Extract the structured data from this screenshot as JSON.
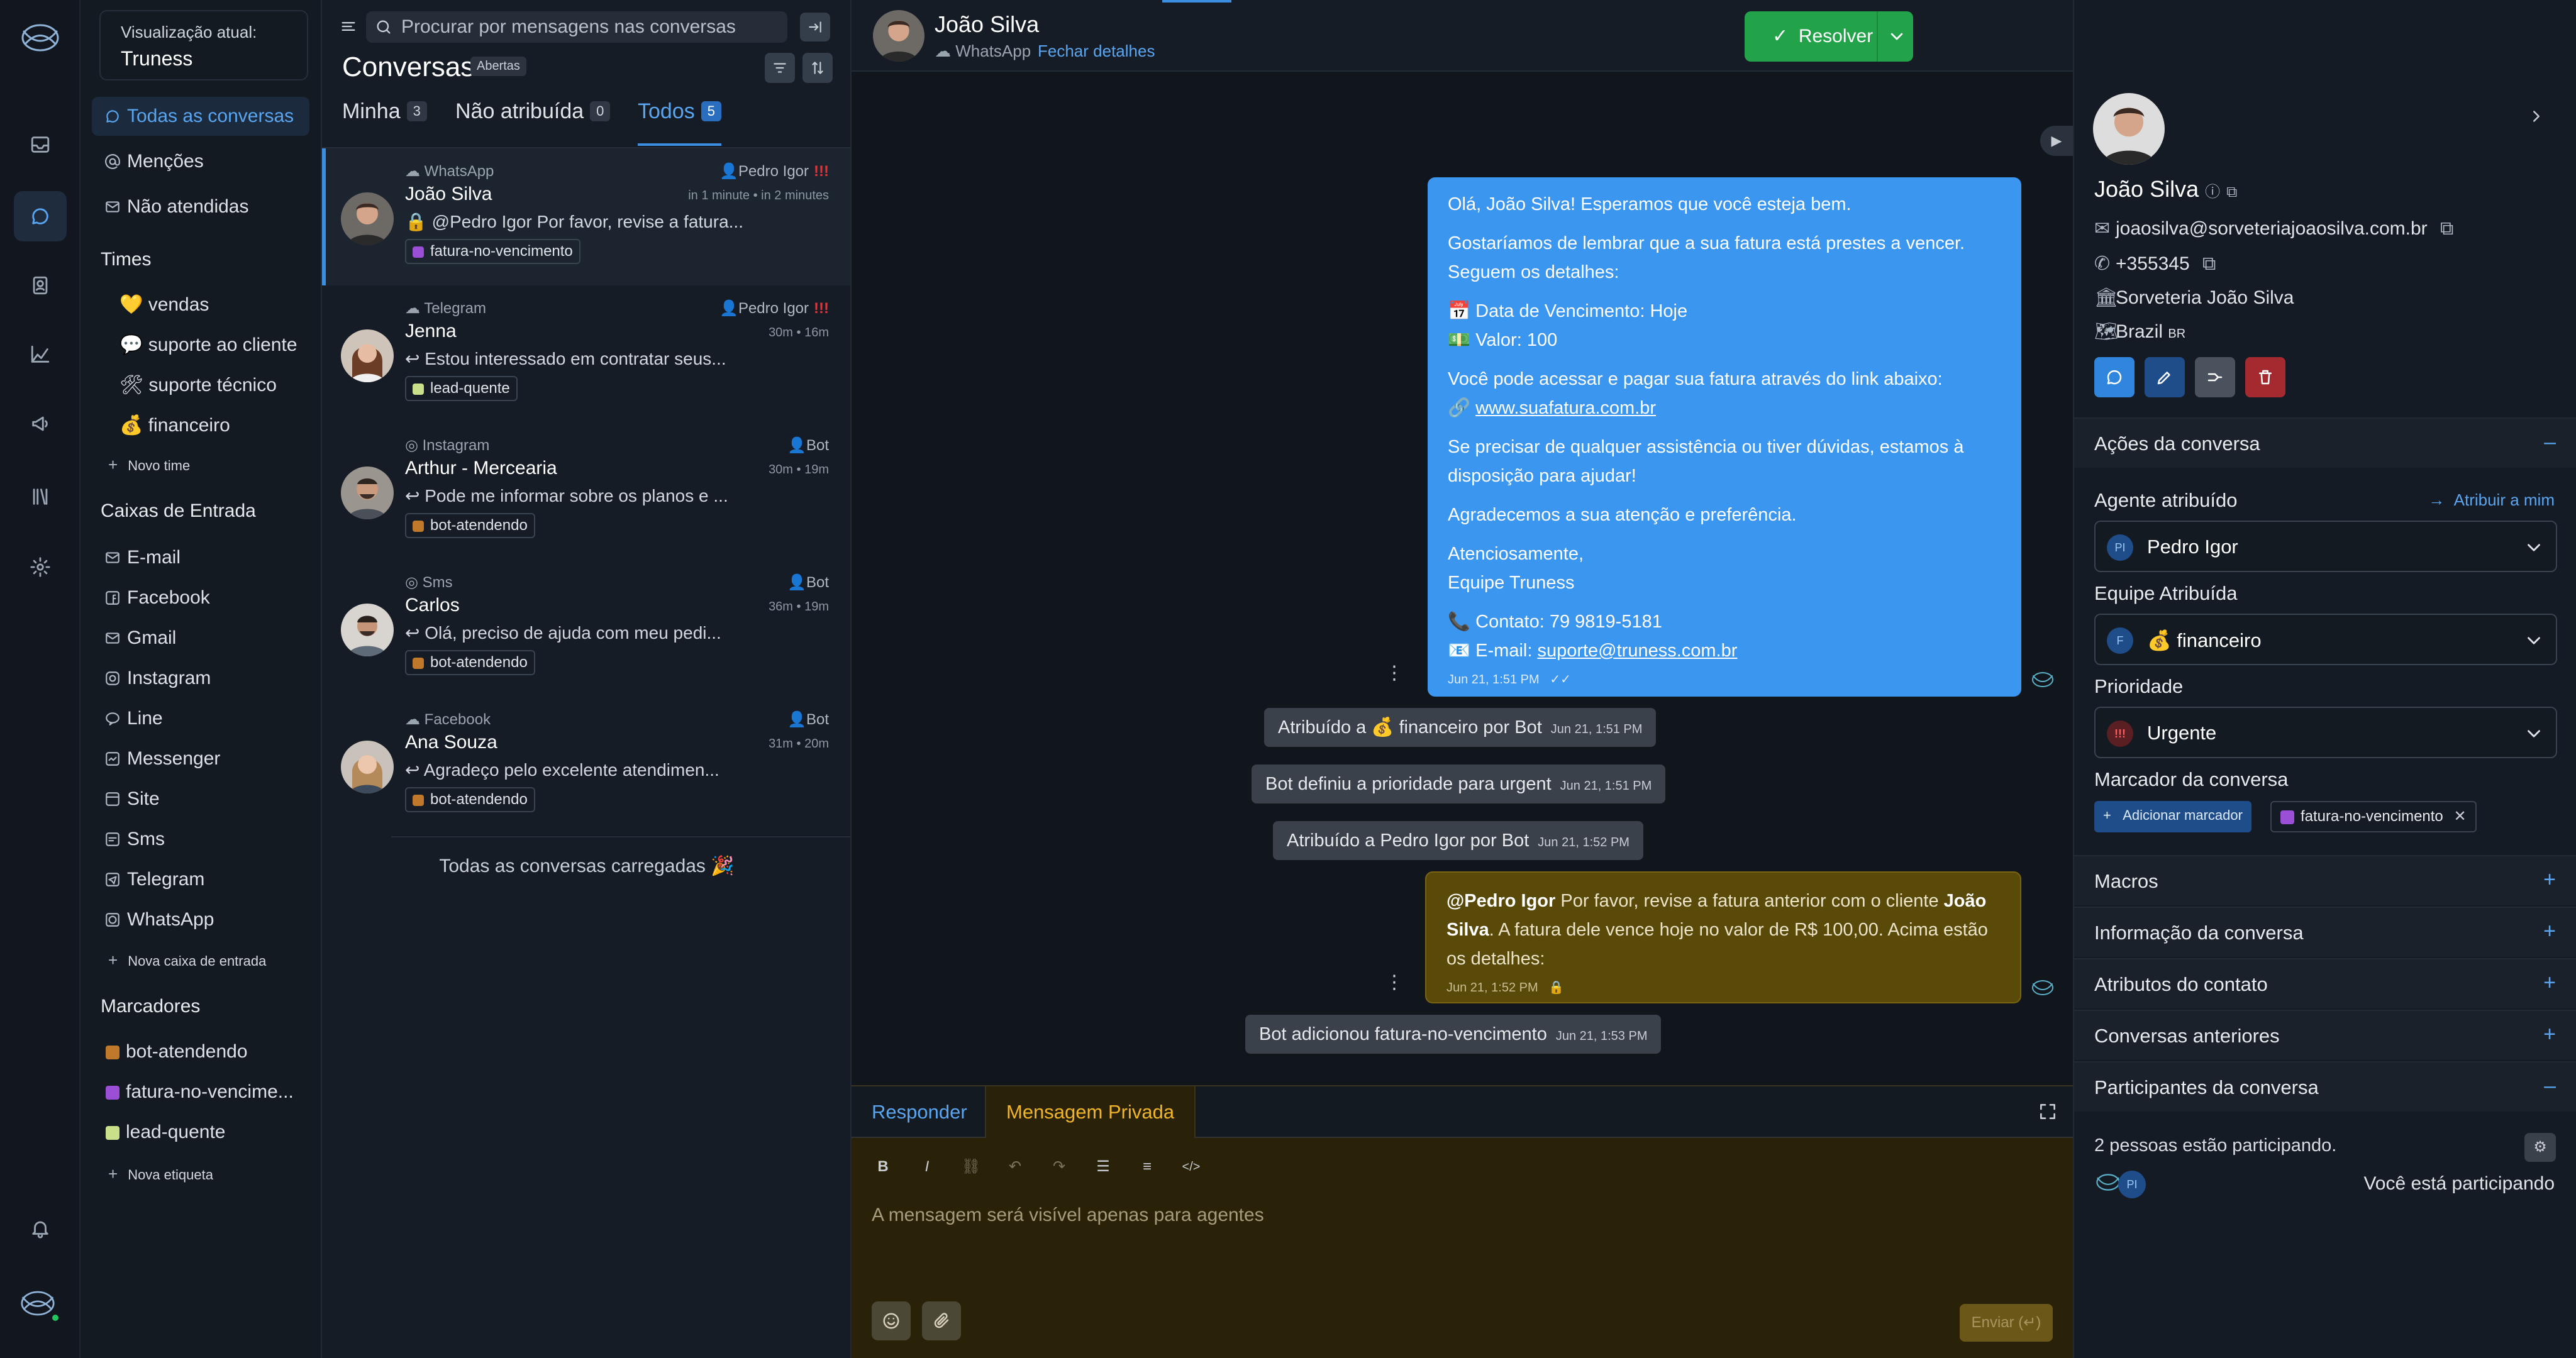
{
  "rail": {
    "icons": [
      "logo-icon",
      "inbox-icon",
      "chat-icon",
      "contacts-icon",
      "reports-icon",
      "campaigns-icon",
      "library-icon",
      "settings-icon",
      "bell-icon",
      "profile-avatar"
    ]
  },
  "nav": {
    "view_label": "Visualização atual:",
    "view_value": "Truness",
    "items": [
      {
        "label": "Todas as conversas"
      },
      {
        "label": "Menções"
      },
      {
        "label": "Não atendidas"
      }
    ],
    "teams_title": "Times",
    "teams": [
      {
        "label": "💛 vendas"
      },
      {
        "label": "💬 suporte ao cliente"
      },
      {
        "label": "🛠 suporte técnico"
      },
      {
        "label": "💰 financeiro"
      }
    ],
    "new_team": "Novo time",
    "inboxes_title": "Caixas de Entrada",
    "inboxes": [
      {
        "label": "E-mail"
      },
      {
        "label": "Facebook"
      },
      {
        "label": "Gmail"
      },
      {
        "label": "Instagram"
      },
      {
        "label": "Line"
      },
      {
        "label": "Messenger"
      },
      {
        "label": "Site"
      },
      {
        "label": "Sms"
      },
      {
        "label": "Telegram"
      },
      {
        "label": "WhatsApp"
      }
    ],
    "new_inbox": "Nova caixa de entrada",
    "labels_title": "Marcadores",
    "labels": [
      {
        "label": "bot-atendendo",
        "color": "#c0782a"
      },
      {
        "label": "fatura-no-vencime...",
        "color": "#9b4fd6"
      },
      {
        "label": "lead-quente",
        "color": "#c8e08a"
      }
    ],
    "new_label": "Nova etiqueta"
  },
  "list": {
    "search_placeholder": "Procurar por mensagens nas conversas",
    "title": "Conversas",
    "status_badge": "Abertas",
    "tabs": [
      {
        "label": "Minha",
        "count": "3"
      },
      {
        "label": "Não atribuída",
        "count": "0"
      },
      {
        "label": "Todos",
        "count": "5"
      }
    ],
    "conversations": [
      {
        "inbox": "WhatsApp",
        "agent": "Pedro Igor",
        "priority": "!!!",
        "name": "João Silva",
        "time": "in 1 minute • in 2 minutes",
        "message": "@Pedro Igor Por favor, revise a fatura...",
        "label": "fatura-no-vencimento",
        "label_color": "#9b4fd6"
      },
      {
        "inbox": "Telegram",
        "agent": "Pedro Igor",
        "priority": "!!!",
        "name": "Jenna",
        "time": "30m • 16m",
        "message": "Estou interessado em contratar seus...",
        "label": "lead-quente",
        "label_color": "#c8e08a"
      },
      {
        "inbox": "Instagram",
        "agent": "Bot",
        "priority": "",
        "name": "Arthur - Mercearia",
        "time": "30m • 19m",
        "message": "Pode me informar sobre os planos e ...",
        "label": "bot-atendendo",
        "label_color": "#c0782a"
      },
      {
        "inbox": "Sms",
        "agent": "Bot",
        "priority": "",
        "name": "Carlos",
        "time": "36m • 19m",
        "message": "Olá, preciso de ajuda com meu pedi...",
        "label": "bot-atendendo",
        "label_color": "#c0782a"
      },
      {
        "inbox": "Facebook",
        "agent": "Bot",
        "priority": "",
        "name": "Ana Souza",
        "time": "31m • 20m",
        "message": "Agradeço pelo excelente atendimen...",
        "label": "bot-atendendo",
        "label_color": "#c0782a"
      }
    ],
    "all_loaded": "Todas as conversas carregadas 🎉"
  },
  "chat": {
    "contact_name": "João Silva",
    "channel": "WhatsApp",
    "close_details": "Fechar detalhes",
    "resolve": "Resolver",
    "outgoing": {
      "p1": "Olá, João Silva! Esperamos que você esteja bem.",
      "p2": "Gostaríamos de lembrar que a sua fatura está prestes a vencer. Seguem os detalhes:",
      "due": "📅 Data de Vencimento: Hoje",
      "value": "💵 Valor: 100",
      "p3": "Você pode acessar e pagar sua fatura através do link abaixo:",
      "link": "www.suafatura.com.br",
      "p4": "Se precisar de qualquer assistência ou tiver dúvidas, estamos à disposição para ajudar!",
      "p5": "Agradecemos a sua atenção e preferência.",
      "p6": "Atenciosamente,",
      "p7": "Equipe Truness",
      "contact": "📞 Contato: 79 9819-5181",
      "email_label": "📧 E-mail: ",
      "email": "suporte@truness.com.br",
      "time": "Jun 21, 1:51 PM"
    },
    "activities": [
      {
        "text": "Atribuído a 💰 financeiro por Bot",
        "time": "Jun 21, 1:51 PM"
      },
      {
        "text": "Bot definiu a prioridade para urgent",
        "time": "Jun 21, 1:51 PM"
      },
      {
        "text": "Atribuído a Pedro Igor por Bot",
        "time": "Jun 21, 1:52 PM"
      },
      {
        "text": "Bot adicionou fatura-no-vencimento",
        "time": "Jun 21, 1:53 PM"
      }
    ],
    "private_note": {
      "mention": "@Pedro Igor",
      "t1": " Por favor, revise a fatura anterior com o cliente ",
      "bold": "João Silva",
      "t2": ". A fatura dele vence hoje no valor de R$ 100,00. Acima estão os detalhes:",
      "time": "Jun 21, 1:52 PM"
    },
    "editor": {
      "reply_tab": "Responder",
      "private_tab": "Mensagem Privada",
      "placeholder": "A mensagem será visível apenas para agentes",
      "send": "Enviar (↵)"
    }
  },
  "panel": {
    "name": "João Silva",
    "email": "joaosilva@sorveteriajoaosilva.com.br",
    "phone": "+355345",
    "company": "Sorveteria João Silva",
    "country": "Brazil",
    "country_code": "BR",
    "actions_title": "Ações da conversa",
    "agent_label": "Agente atribuído",
    "assign_me": "Atribuir a mim",
    "agent_value": "Pedro Igor",
    "agent_initials": "PI",
    "team_label": "Equipe Atribuída",
    "team_value": "💰 financeiro",
    "team_initial": "F",
    "priority_label": "Prioridade",
    "priority_value": "Urgente",
    "tags_label": "Marcador da conversa",
    "add_tag": "Adicionar marcador",
    "tag": "fatura-no-vencimento",
    "sections": [
      {
        "label": "Macros"
      },
      {
        "label": "Informação da conversa"
      },
      {
        "label": "Atributos do contato"
      },
      {
        "label": "Conversas anteriores"
      }
    ],
    "participants_title": "Participantes da conversa",
    "participants_count": "2 pessoas estão participando.",
    "participant_initials": "PI",
    "you_participate": "Você está participando"
  },
  "colors": {
    "accent": "#3b8ee0",
    "resolve": "#22a34a",
    "private": "#5a4a0a",
    "urgent": "#e2353a"
  }
}
